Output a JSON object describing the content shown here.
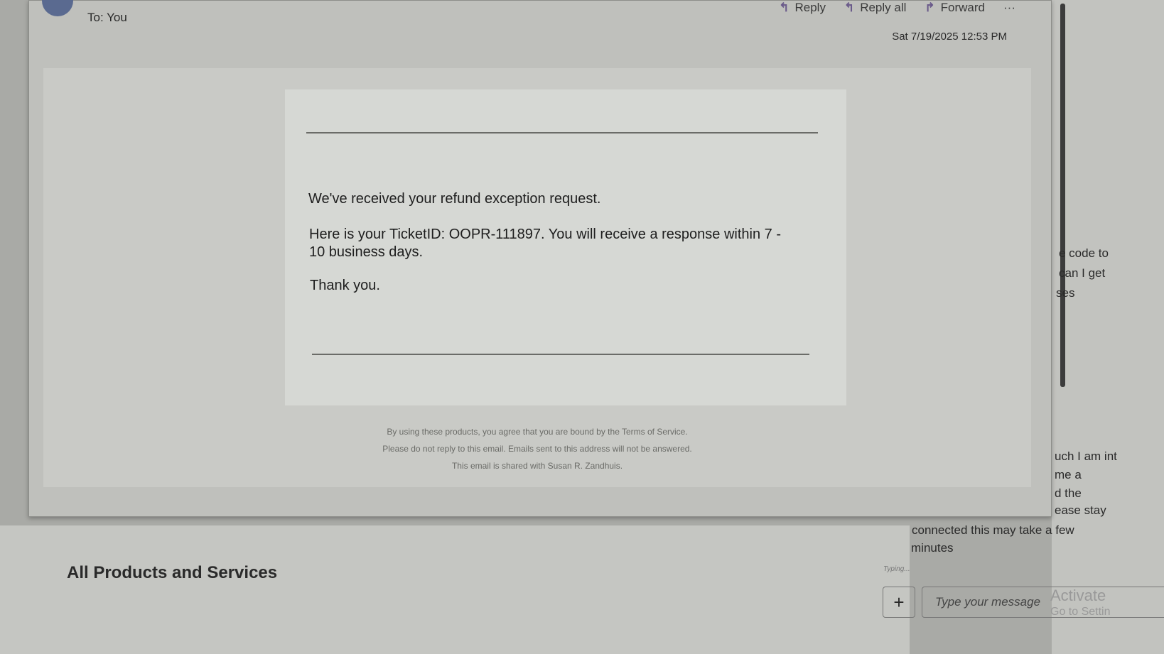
{
  "email": {
    "to_label": "To:",
    "to_value": "You",
    "date": "Sat 7/19/2025 12:53 PM",
    "actions": [
      "Reply",
      "Reply all",
      "Forward",
      "···"
    ],
    "body": {
      "line1": "We've received your refund exception request.",
      "line2": "Here is your TicketID: OOPR-111897. You will receive a response within 7 -",
      "line3": "10 business days.",
      "line4": "Thank you."
    },
    "footer": [
      "By using these products, you agree that you are bound by the Terms of Service.",
      "Please do not reply to this email. Emails sent to this address will not be answered.",
      "This email is shared with Susan R. Zandhuis."
    ]
  },
  "page": {
    "section_title": "All Products and Services"
  },
  "chat": {
    "fragments_top": [
      "e code to",
      "can I get",
      "ses"
    ],
    "fragments_mid": [
      "uch I am int",
      "me a",
      "d the",
      "ease stay"
    ],
    "message_tail": [
      "connected this may take a few",
      "minutes"
    ],
    "typing": "Typing...",
    "add_label": "+",
    "input_placeholder": "Type your message"
  },
  "watermark": {
    "line1": "Activate",
    "line2": "Go to Settin"
  }
}
